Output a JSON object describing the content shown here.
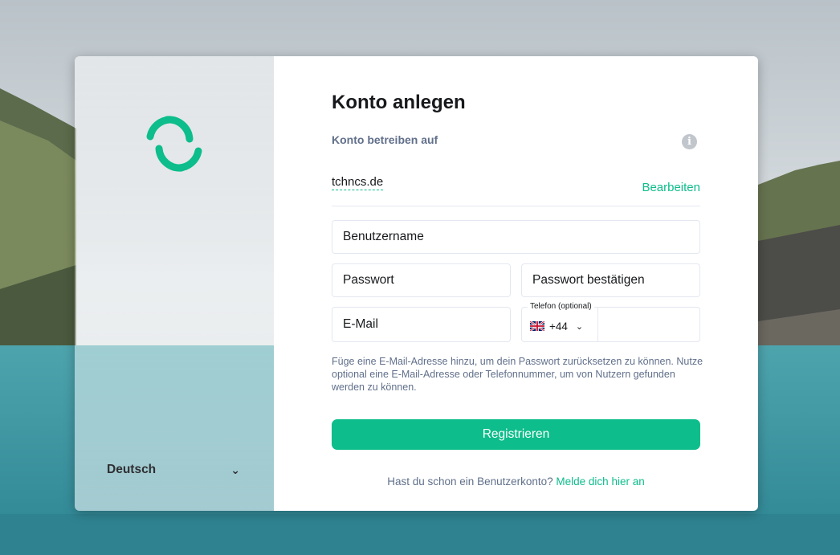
{
  "lang": {
    "selected": "Deutsch"
  },
  "form": {
    "title": "Konto anlegen",
    "host_label": "Konto betreiben auf",
    "server_name": "tchncs.de",
    "edit_label": "Bearbeiten",
    "username_placeholder": "Benutzername",
    "password_placeholder": "Passwort",
    "confirm_placeholder": "Passwort bestätigen",
    "email_placeholder": "E-Mail",
    "phone_label": "Telefon (optional)",
    "phone_dial_code": "+44",
    "hint": "Füge eine E-Mail-Adresse hinzu, um dein Passwort zurücksetzen zu können. Nutze optional eine E-Mail-Adresse oder Telefonnummer, um von Nutzern gefunden werden zu können.",
    "register_label": "Registrieren",
    "login_prompt": "Hast du schon ein Benutzerkonto?",
    "login_link": "Melde dich hier an"
  },
  "colors": {
    "accent": "#0dbd8b",
    "muted_text": "#61708b",
    "border": "#e3e8f0"
  },
  "icons": {
    "logo": "element-logo-icon",
    "info": "info-icon",
    "lang_chevron": "chevron-down-icon",
    "flag": "uk-flag-icon"
  }
}
